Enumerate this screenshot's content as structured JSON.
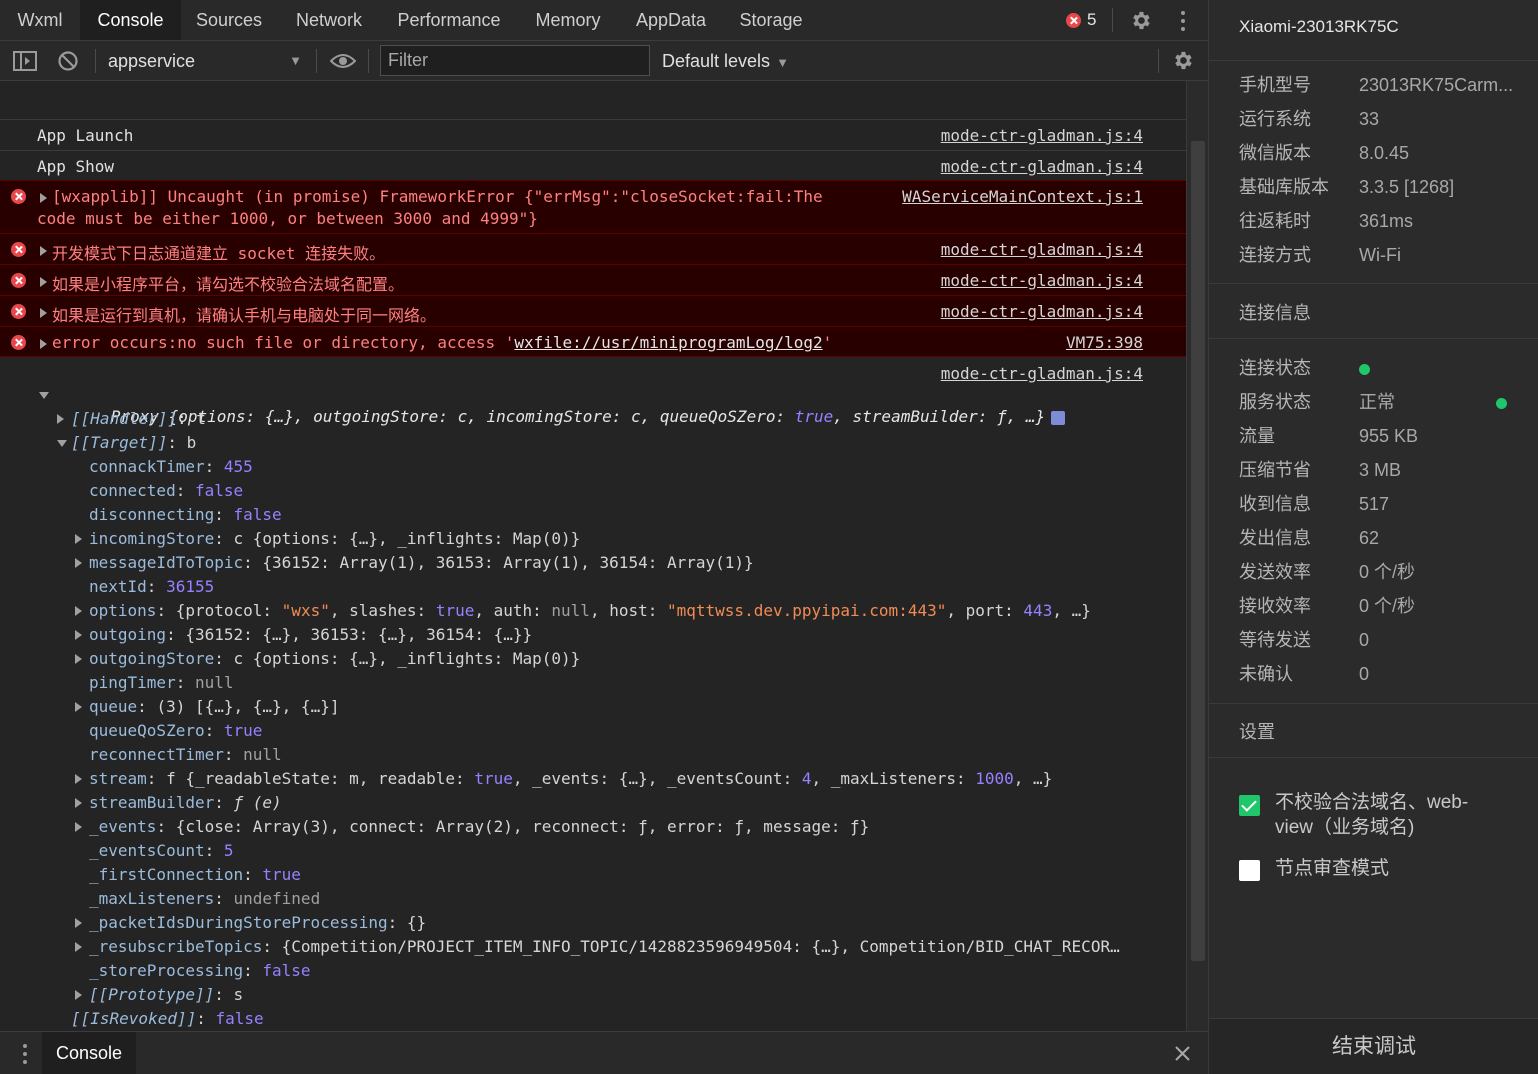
{
  "tabs": [
    {
      "label": "Wxml",
      "active": false
    },
    {
      "label": "Console",
      "active": true
    },
    {
      "label": "Sources",
      "active": false
    },
    {
      "label": "Network",
      "active": false
    },
    {
      "label": "Performance",
      "active": false
    },
    {
      "label": "Memory",
      "active": false
    },
    {
      "label": "AppData",
      "active": false
    },
    {
      "label": "Storage",
      "active": false
    }
  ],
  "error_count": "5",
  "toolbar": {
    "context": "appservice",
    "filter_placeholder": "Filter",
    "levels": "Default levels"
  },
  "messages": {
    "m1": {
      "text": "App Launch",
      "source": "mode-ctr-gladman.js:4"
    },
    "m2": {
      "text": "App Show",
      "source": "mode-ctr-gladman.js:4"
    },
    "m3": {
      "line1": "[wxapplib]] Uncaught (in promise) FrameworkError {\"errMsg\":\"closeSocket:fail:The",
      "line2": "code must be either 1000, or between 3000 and 4999\"}",
      "source": "WAServiceMainContext.js:1"
    },
    "m4": {
      "text": "开发模式下日志通道建立 socket 连接失败。",
      "source": "mode-ctr-gladman.js:4"
    },
    "m5": {
      "text": "如果是小程序平台，请勾选不校验合法域名配置。",
      "source": "mode-ctr-gladman.js:4"
    },
    "m6": {
      "text": "如果是运行到真机，请确认手机与电脑处于同一网络。",
      "source": "mode-ctr-gladman.js:4"
    },
    "m7": {
      "prefix": "error occurs:no such file or directory, access '",
      "link": "wxfile://usr/miniprogramLog/log2",
      "suffix": "'",
      "source": "VM75:398"
    },
    "m8": {
      "source": "mode-ctr-gladman.js:4"
    }
  },
  "proxy": {
    "summary_prefix": "Proxy {options: {…}, outgoingStore: c, incomingStore: c, queueQoSZero: ",
    "summary_true": "true",
    "summary_suffix": ", streamBuilder: ƒ, …}",
    "handler_key": "[[Handler]]",
    "handler_val": "t",
    "target_key": "[[Target]]",
    "target_val": "b",
    "props": {
      "connackTimer": {
        "key": "connackTimer",
        "val": "455"
      },
      "connected": {
        "key": "connected",
        "val": "false"
      },
      "disconnecting": {
        "key": "disconnecting",
        "val": "false"
      },
      "incomingStore": {
        "key": "incomingStore",
        "val": "c {options: {…}, _inflights: Map(0)}"
      },
      "messageIdToTopic": {
        "key": "messageIdToTopic",
        "val": "{36152: Array(1), 36153: Array(1), 36154: Array(1)}"
      },
      "nextId": {
        "key": "nextId",
        "val": "36155"
      },
      "options": {
        "key": "options",
        "p1": "{protocol: ",
        "s1": "\"wxs\"",
        "p2": ", slashes: ",
        "b1": "true",
        "p3": ", auth: ",
        "n1": "null",
        "p4": ", host: ",
        "s2": "\"mqttwss.dev.ppyipai.com:443\"",
        "p5": ", port: ",
        "num": "443",
        "p6": ", …}"
      },
      "outgoing": {
        "key": "outgoing",
        "val": "{36152: {…}, 36153: {…}, 36154: {…}}"
      },
      "outgoingStore": {
        "key": "outgoingStore",
        "val": "c {options: {…}, _inflights: Map(0)}"
      },
      "pingTimer": {
        "key": "pingTimer",
        "val": "null"
      },
      "queue": {
        "key": "queue",
        "val": "(3) [{…}, {…}, {…}]"
      },
      "queueQoSZero": {
        "key": "queueQoSZero",
        "val": "true"
      },
      "reconnectTimer": {
        "key": "reconnectTimer",
        "val": "null"
      },
      "stream": {
        "key": "stream",
        "p1": "f {_readableState: m, readable: ",
        "b1": "true",
        "p2": ", _events: {…}, _eventsCount: ",
        "n1": "4",
        "p3": ", _maxListeners: ",
        "n2": "1000",
        "p4": ", …}"
      },
      "streamBuilder": {
        "key": "streamBuilder",
        "val": "ƒ (e)"
      },
      "_events": {
        "key": "_events",
        "val": "{close: Array(3), connect: Array(2), reconnect: ƒ, error: ƒ, message: ƒ}"
      },
      "_eventsCount": {
        "key": "_eventsCount",
        "val": "5"
      },
      "_firstConnection": {
        "key": "_firstConnection",
        "val": "true"
      },
      "_maxListeners": {
        "key": "_maxListeners",
        "val": "undefined"
      },
      "_packetIdsDuringStoreProcessing": {
        "key": "_packetIdsDuringStoreProcessing",
        "val": "{}"
      },
      "_resubscribeTopics": {
        "key": "_resubscribeTopics",
        "val": "{Competition/PROJECT_ITEM_INFO_TOPIC/1428823596949504: {…}, Competition/BID_CHAT_RECOR…"
      },
      "_storeProcessing": {
        "key": "_storeProcessing",
        "val": "false"
      },
      "prototype": {
        "key": "[[Prototype]]",
        "val": "s"
      }
    },
    "revoked_key": "[[IsRevoked]]",
    "revoked_val": "false"
  },
  "drawer": {
    "tab": "Console"
  },
  "side": {
    "device": "Xiaomi-23013RK75C",
    "info": {
      "model": {
        "label": "手机型号",
        "value": "23013RK75Carm..."
      },
      "os": {
        "label": "运行系统",
        "value": "33"
      },
      "wechat": {
        "label": "微信版本",
        "value": "8.0.45"
      },
      "sdk": {
        "label": "基础库版本",
        "value": "3.3.5 [1268]"
      },
      "rtt": {
        "label": "往返耗时",
        "value": "361ms"
      },
      "conn": {
        "label": "连接方式",
        "value": "Wi-Fi"
      }
    },
    "conn_info_title": "连接信息",
    "stats": {
      "conn_state": {
        "label": "连接状态",
        "value": ""
      },
      "service_state": {
        "label": "服务状态",
        "value": "正常"
      },
      "traffic": {
        "label": "流量",
        "value": "955 KB"
      },
      "compress": {
        "label": "压缩节省",
        "value": "3 MB"
      },
      "received": {
        "label": "收到信息",
        "value": "517"
      },
      "sent": {
        "label": "发出信息",
        "value": "62"
      },
      "send_rate": {
        "label": "发送效率",
        "value": "0 个/秒"
      },
      "recv_rate": {
        "label": "接收效率",
        "value": "0 个/秒"
      },
      "pending": {
        "label": "等待发送",
        "value": "0"
      },
      "unack": {
        "label": "未确认",
        "value": "0"
      }
    },
    "settings_title": "设置",
    "settings": {
      "skip_domain": {
        "label": "不校验合法域名、web-view（业务域名)",
        "checked": true
      },
      "node_inspect": {
        "label": "节点审查模式",
        "checked": false
      }
    },
    "end_button": "结束调试"
  },
  "colors": {
    "error_bg": "#290000",
    "error_text": "#ff8080",
    "accent_green": "#1fc66a"
  }
}
